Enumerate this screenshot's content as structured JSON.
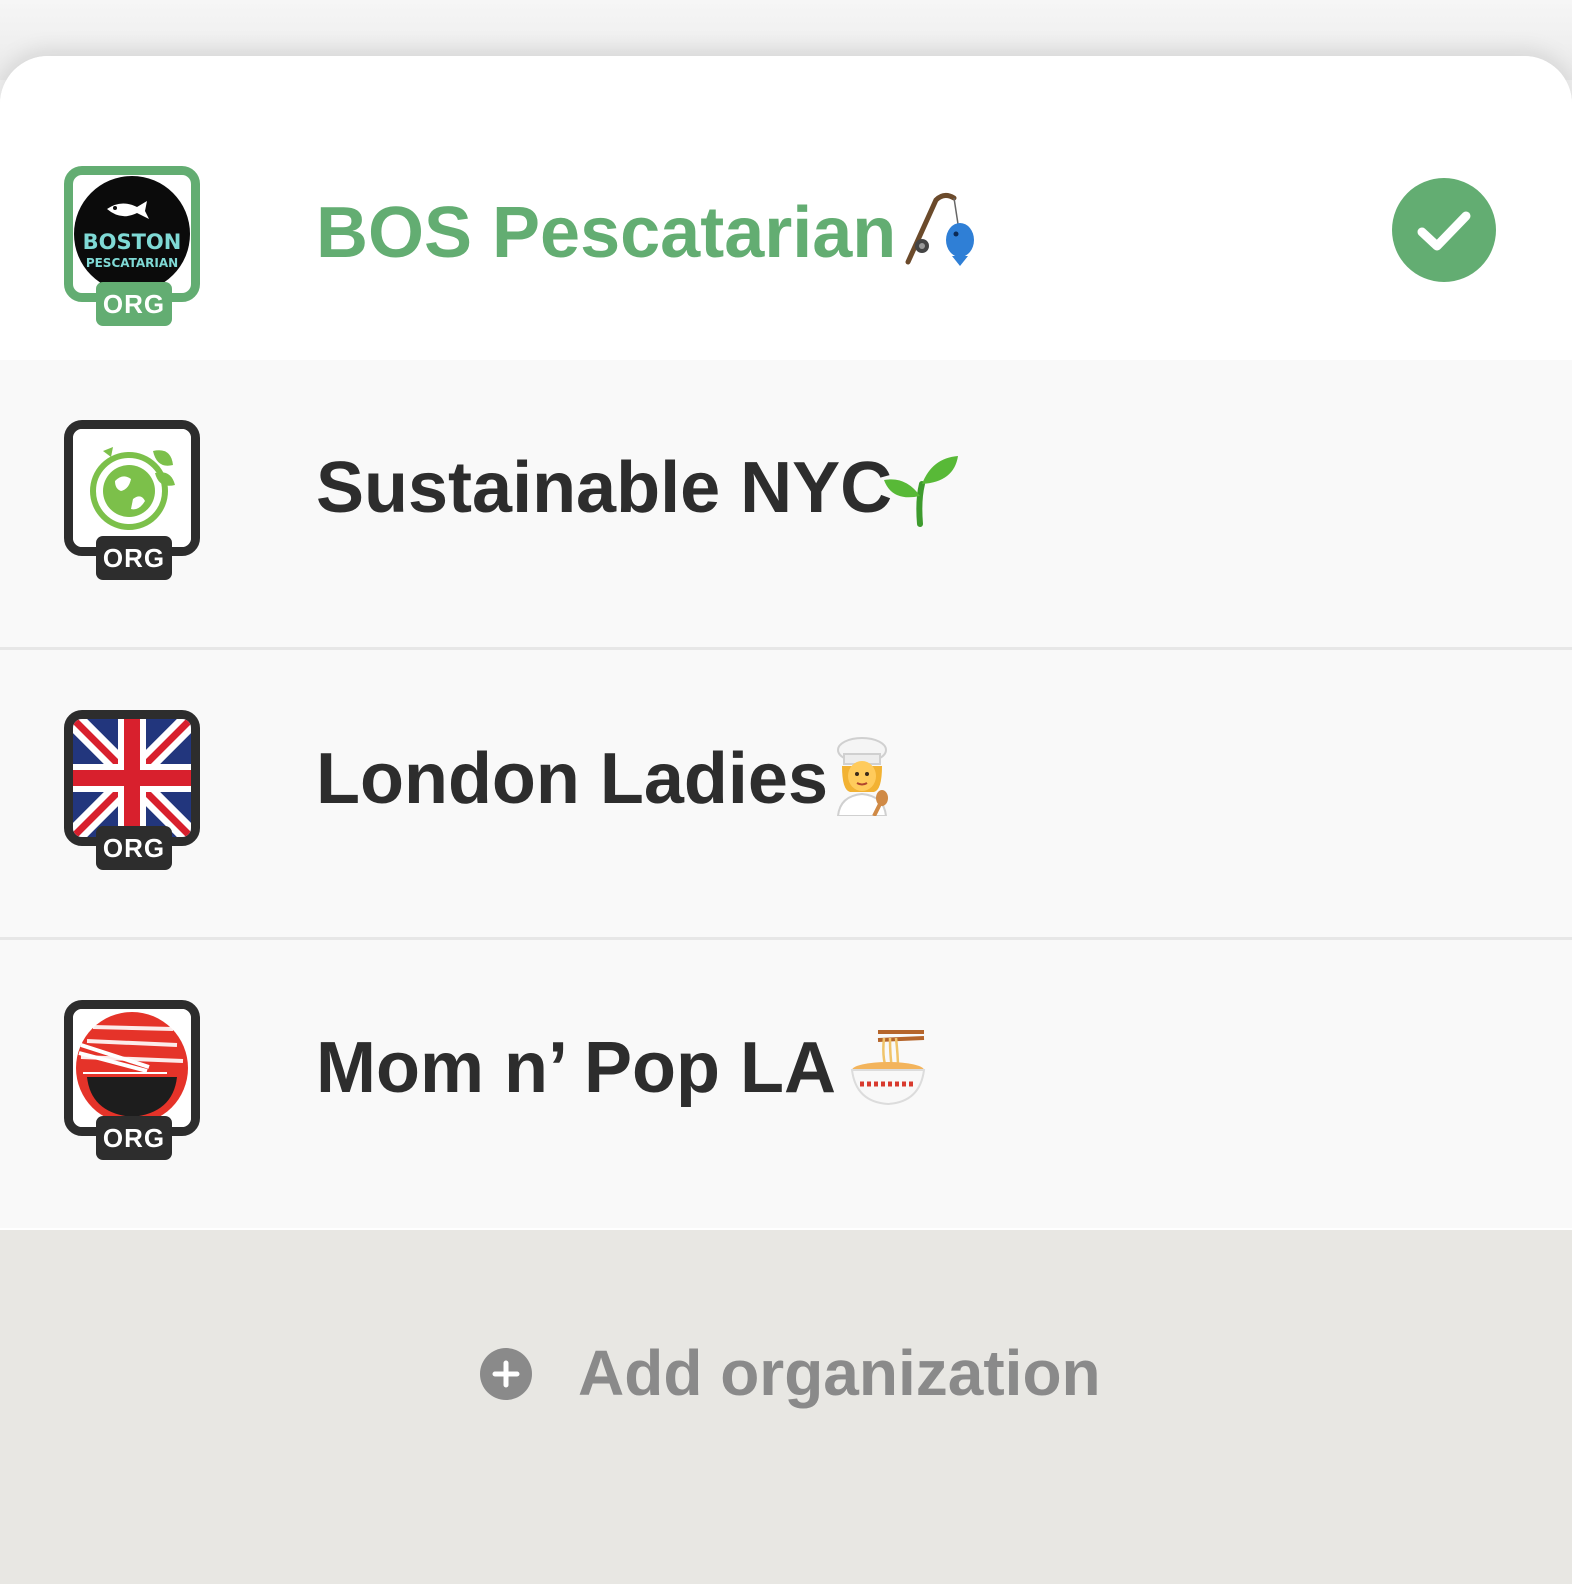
{
  "sheet": {
    "handle": "drag-handle"
  },
  "organizations": [
    {
      "name": "BOS Pescatarian",
      "badge": "ORG",
      "emoji": "fishing-pole-emoji",
      "logo_top": "BOSTON",
      "logo_bottom": "PESCATARIAN",
      "selected": true
    },
    {
      "name": "Sustainable NYC",
      "badge": "ORG",
      "emoji": "seedling-emoji",
      "selected": false
    },
    {
      "name": "London Ladies",
      "badge": "ORG",
      "emoji": "woman-cook-emoji",
      "selected": false
    },
    {
      "name": "Mom n’ Pop LA",
      "badge": "ORG",
      "emoji": "noodle-bowl-emoji",
      "selected": false
    }
  ],
  "add_organization": {
    "label": "Add organization",
    "icon": "plus-circle-icon"
  },
  "colors": {
    "accent": "#63ad72",
    "text": "#2d2d2d",
    "muted": "#8a8a8a",
    "footer_bg": "#e8e7e3"
  }
}
